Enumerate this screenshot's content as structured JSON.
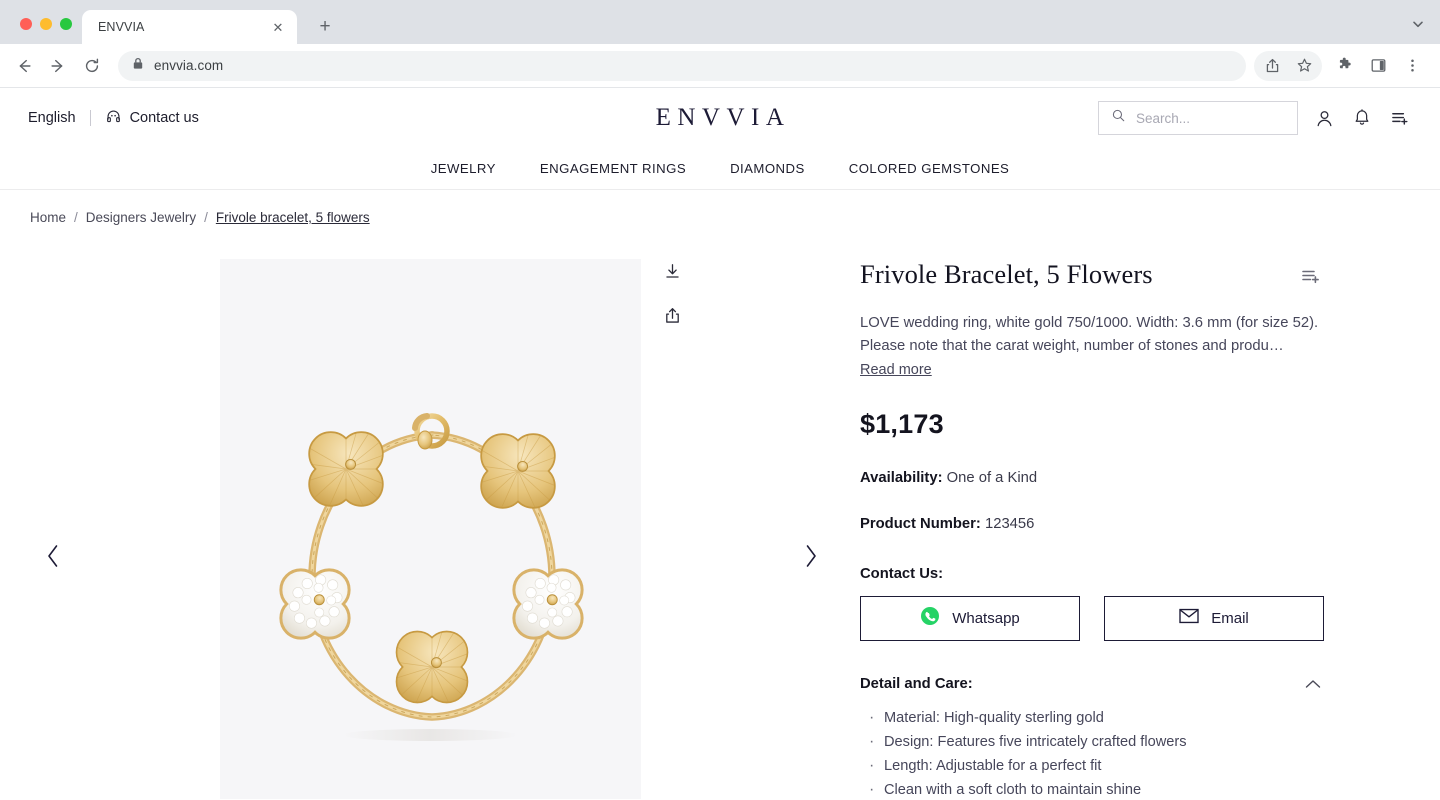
{
  "browser": {
    "tab_title": "ENVVIA",
    "tab_close_label": "✕",
    "new_tab_label": "+",
    "url": "envvia.com",
    "back_icon": "back-arrow-icon",
    "forward_icon": "forward-arrow-icon",
    "reload_icon": "reload-icon",
    "lock_icon": "lock-icon",
    "share_icon": "share-icon",
    "bookmark_icon": "star-icon",
    "extensions_icon": "puzzle-icon",
    "sidepanel_icon": "side-panel-icon",
    "menu_icon": "three-dot-menu-icon",
    "tablist_icon": "chevron-down-icon"
  },
  "header": {
    "language": "English",
    "contact_label": "Contact us",
    "brand": "ENVVIA",
    "search_placeholder": "Search...",
    "search_value": "",
    "account_icon": "person-icon",
    "notification_icon": "bell-icon",
    "list_icon": "add-to-list-icon",
    "brand_color": "#1d1b36"
  },
  "nav": {
    "items": [
      {
        "label": "JEWELRY"
      },
      {
        "label": "ENGAGEMENT RINGS"
      },
      {
        "label": "DIAMONDS"
      },
      {
        "label": "COLORED GEMSTONES"
      }
    ]
  },
  "breadcrumb": {
    "home": "Home",
    "sep1": "/",
    "category": "Designers Jewelry",
    "sep2": "/",
    "current": "Frivole bracelet, 5 flowers"
  },
  "gallery": {
    "prev_label": "‹",
    "next_label": "›",
    "download_icon": "download-icon",
    "share_icon": "share-icon",
    "image_alt": "Gold Frivole bracelet with five flower motifs",
    "background_color": "#f6f6f8",
    "gold_color": "#e3bd6b"
  },
  "product": {
    "title": "Frivole Bracelet, 5 Flowers",
    "description": "LOVE wedding ring, white gold 750/1000. Width: 3.6 mm (for size 52). Please note that the carat weight, number of stones and produ…",
    "read_more": "Read more",
    "price": "$1,173",
    "availability_label": "Availability:",
    "availability_value": "One of a Kind",
    "product_number_label": "Product Number:",
    "product_number_value": "123456",
    "contact_label": "Contact Us:",
    "whatsapp_label": "Whatsapp",
    "email_label": "Email",
    "whatsapp_color": "#25D366",
    "add_to_list_icon": "add-to-list-icon"
  },
  "detail_care": {
    "title": "Detail and Care:",
    "expanded": true,
    "chevron_icon": "chevron-up-icon",
    "items": [
      {
        "text": "Material: High-quality sterling gold"
      },
      {
        "text": "Design: Features five intricately crafted flowers"
      },
      {
        "text": "Length: Adjustable for a perfect fit"
      },
      {
        "text": "Clean with a soft cloth to maintain shine"
      }
    ]
  }
}
